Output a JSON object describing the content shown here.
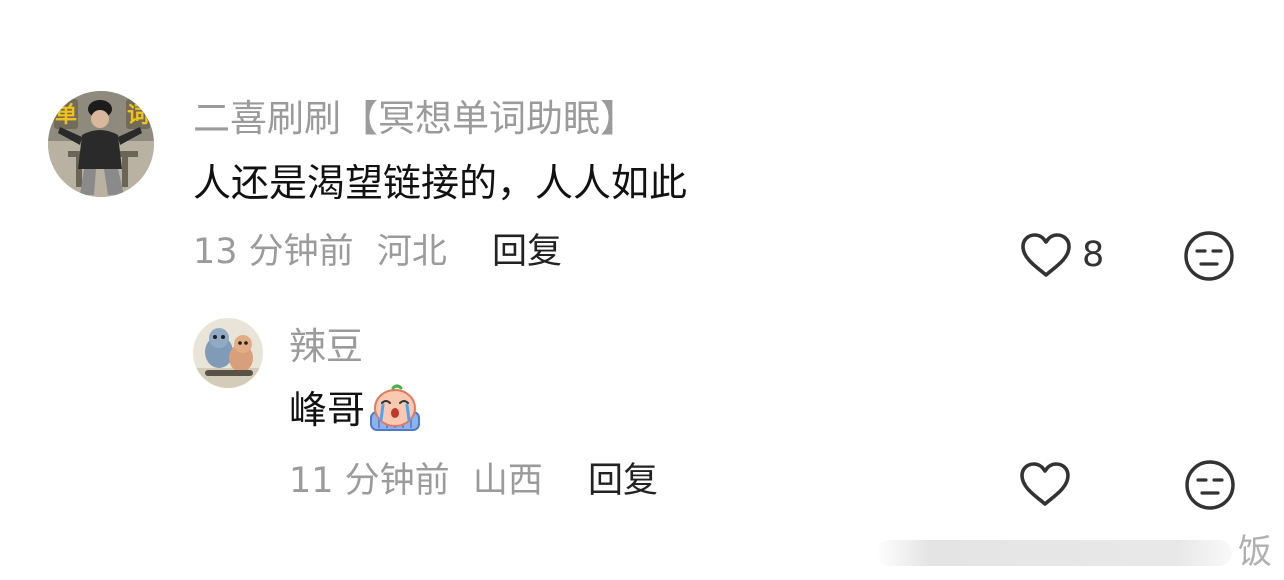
{
  "comments": [
    {
      "username": "二喜刷刷【冥想单词助眠】",
      "avatar_text": [
        "单",
        "词"
      ],
      "content": "人还是渴望链接的，人人如此",
      "time": "13 分钟前",
      "location": "河北",
      "reply_label": "回复",
      "like_count": "8"
    }
  ],
  "replies": [
    {
      "username": "辣豆",
      "content": "峰哥",
      "emoji": "crying-emoji",
      "time": "11 分钟前",
      "location": "山西",
      "reply_label": "回复"
    }
  ],
  "watermark": "饭",
  "icons": {
    "like": "heart-icon",
    "reaction": "neutral-face-icon"
  },
  "colors": {
    "secondary_text": "#9b9b9b",
    "primary_text": "#111111",
    "icon_stroke": "#333333"
  }
}
